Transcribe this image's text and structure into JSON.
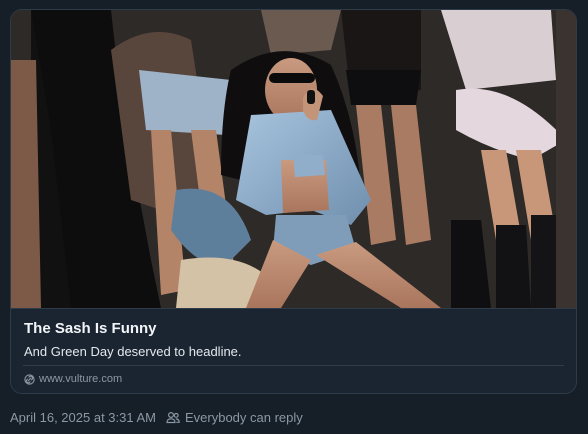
{
  "link_card": {
    "image_alt": "Performer in sunglasses and a denim outfit singing on stage surrounded by dancers",
    "headline": "The Sash Is Funny",
    "description": "And Green Day deserved to headline.",
    "domain": "www.vulture.com",
    "domain_icon": "link-icon"
  },
  "post_meta": {
    "timestamp": "April 16, 2025 at 3:31 AM",
    "reply_setting": "Everybody can reply",
    "reply_icon": "people-icon"
  },
  "colors": {
    "background": "#161e28",
    "border": "#2e3b49",
    "secondary_text": "#8b98a5"
  }
}
